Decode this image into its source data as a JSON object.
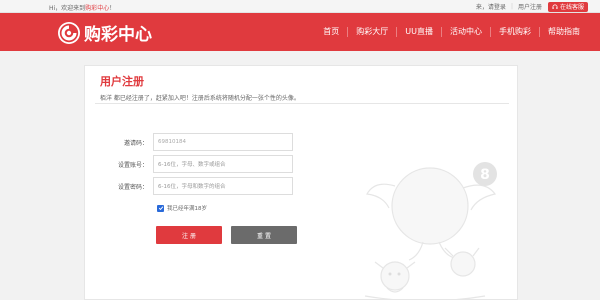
{
  "topbar": {
    "welcome_prefix": "Hi，欢迎来到",
    "welcome_brand": "购彩中心",
    "welcome_suffix": "！",
    "login_text": "来，请登录",
    "register_text": "用户注册",
    "service_label": "在线客服"
  },
  "header": {
    "logo_text": "购彩中心",
    "nav": [
      "首页",
      "购彩大厅",
      "UU直播",
      "活动中心",
      "手机购彩",
      "帮助指南"
    ]
  },
  "form": {
    "title": "用户注册",
    "subtitle": "栢洋 都已经注册了，赶紧加入吧！注册后系统将随机分配一张个性的头像。",
    "invite_label": "邀请码：",
    "invite_value": "69810184",
    "account_label": "设置账号：",
    "account_placeholder": "6-16位，字母、数字或组合",
    "password_label": "设置密码：",
    "password_placeholder": "6-16位，字母和数字的组合",
    "agree_text": "我已经年满18岁",
    "submit_label": "注 册",
    "reset_label": "重 置"
  },
  "colors": {
    "brand_red": "#e03a3e",
    "reset_gray": "#6b6b6b",
    "checkbox_blue": "#2a6ad9"
  },
  "icons": {
    "logo": "swirl-logo-icon",
    "service": "headset-icon",
    "checkbox": "check-icon",
    "mascot": "lottery-ball-mascot-icon"
  }
}
